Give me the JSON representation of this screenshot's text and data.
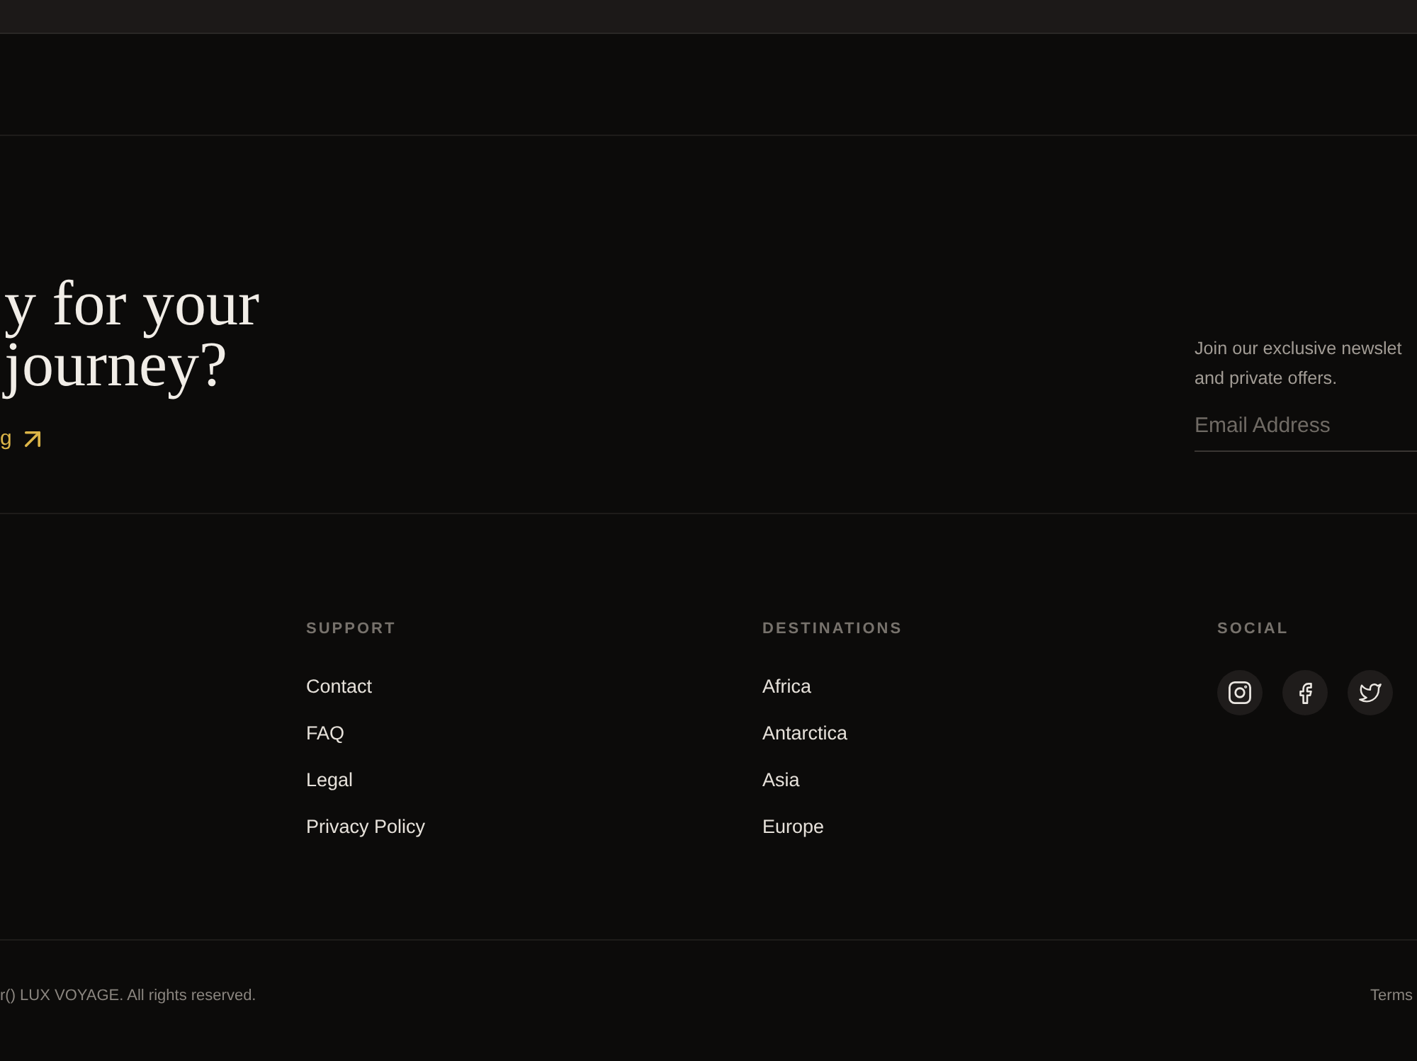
{
  "cta": {
    "heading_lines": [
      "y for your",
      "journey?"
    ],
    "link": {
      "label": "g"
    }
  },
  "newsletter": {
    "text_lines": [
      "Join our exclusive newslet",
      "and private offers."
    ],
    "email_field": {
      "placeholder": "Email Address"
    }
  },
  "footer_columns": [
    {
      "kind": "links",
      "title": "SUPPORT",
      "links": [
        "Contact",
        "FAQ",
        "Legal",
        "Privacy Policy"
      ]
    },
    {
      "kind": "links",
      "title": "DESTINATIONS",
      "links": [
        "Africa",
        "Antarctica",
        "Asia",
        "Europe"
      ]
    },
    {
      "kind": "social",
      "title": "SOCIAL"
    }
  ],
  "bottom_bar": {
    "copyright": "r() LUX VOYAGE. All rights reserved.",
    "links": [
      "Terms"
    ]
  }
}
